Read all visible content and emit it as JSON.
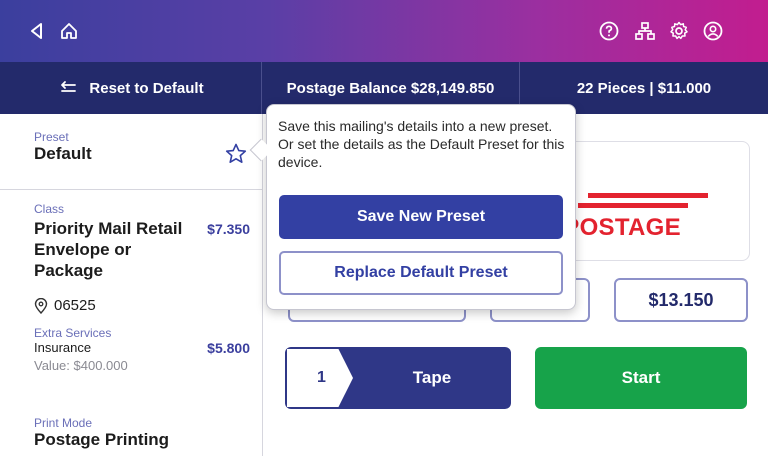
{
  "status_bar": {
    "icons": [
      "back-icon",
      "home-icon",
      "help-icon",
      "network-icon",
      "settings-icon",
      "account-icon"
    ]
  },
  "action_bar": {
    "reset_label": "Reset to Default",
    "balance": "Postage Balance $28,149.850",
    "pieces": "22 Pieces | $11.000"
  },
  "left_panel": {
    "preset": {
      "label": "Preset",
      "value": "Default"
    },
    "class": {
      "label": "Class",
      "name": "Priority Mail Retail Envelope or Package",
      "price": "$7.350"
    },
    "zip": "06525",
    "extra_services": {
      "label": "Extra Services",
      "name": "Insurance",
      "price": "$5.800",
      "value": "Value: $400.000"
    },
    "print_mode": {
      "label": "Print Mode",
      "value": "Postage Printing"
    }
  },
  "main": {
    "postage_brand": "S POSTAGE",
    "amount": "$13.150",
    "tape": {
      "count": "1",
      "label": "Tape"
    },
    "start_label": "Start"
  },
  "popover": {
    "message": "Save this mailing's details into a new preset. Or set the details as the Default Preset for this device.",
    "save_label": "Save New Preset",
    "replace_label": "Replace Default Preset"
  },
  "colors": {
    "header_gradient_start": "#3b3f9e",
    "header_gradient_end": "#c21d8f",
    "action_bar": "#232a6b",
    "primary": "#3340a3",
    "start": "#17a34a",
    "brand_red": "#e3232f"
  }
}
